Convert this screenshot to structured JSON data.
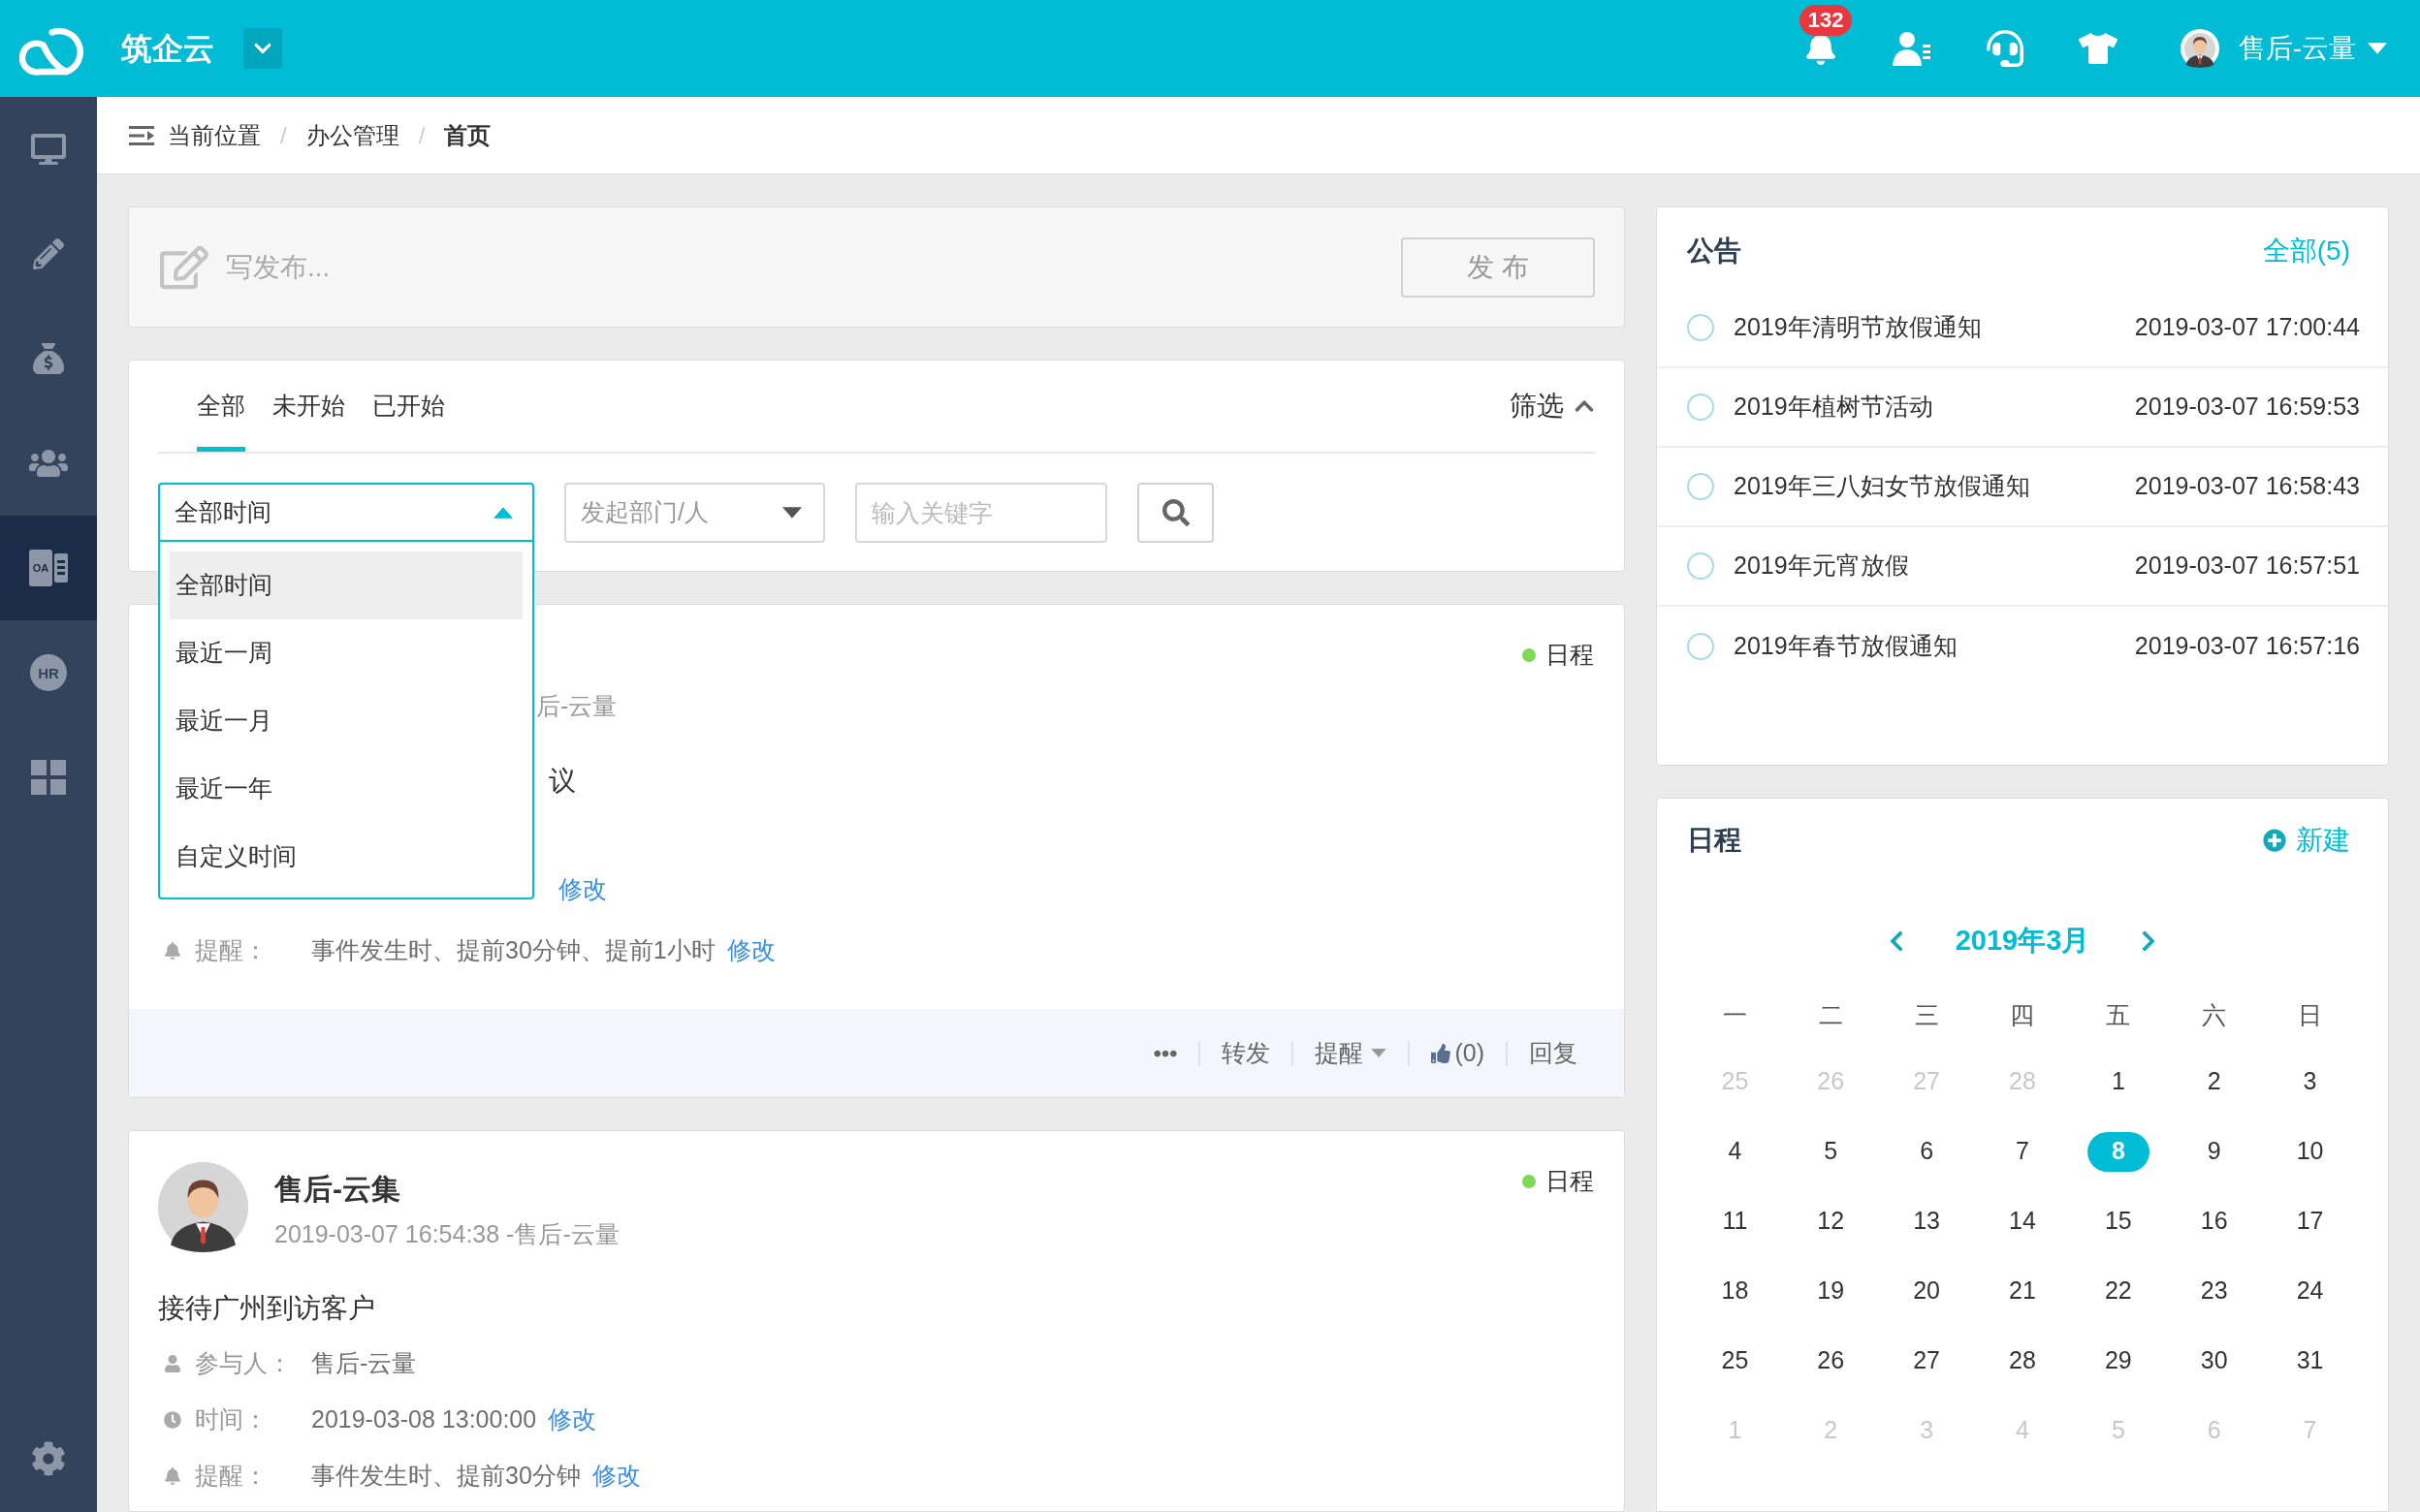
{
  "header": {
    "brand": "筑企云",
    "notifications": {
      "count": "132"
    },
    "user": {
      "name": "售后-云量"
    }
  },
  "sidebar": {
    "items": [
      {
        "selected": false
      },
      {
        "selected": false
      },
      {
        "selected": false
      },
      {
        "selected": false
      },
      {
        "selected": true,
        "icon_text": "OA"
      },
      {
        "selected": false,
        "icon_text": "HR"
      },
      {
        "selected": false
      }
    ]
  },
  "breadcrumb": {
    "items": [
      {
        "kind": "label",
        "text": "当前位置"
      },
      {
        "kind": "separator",
        "text": "/"
      },
      {
        "kind": "link",
        "text": "办公管理"
      },
      {
        "kind": "separator",
        "text": "/"
      },
      {
        "kind": "current",
        "text": "首页"
      }
    ]
  },
  "composer": {
    "placeholder": "写发布...",
    "button": "发 布"
  },
  "filter": {
    "tabs": [
      {
        "label": "全部",
        "selected": true
      },
      {
        "label": "未开始",
        "selected": false
      },
      {
        "label": "已开始",
        "selected": false
      }
    ],
    "toggle": {
      "label": "筛选",
      "expanded": true
    },
    "time_select": {
      "value": "全部时间",
      "expanded": true,
      "options": [
        {
          "label": "全部时间",
          "selected": true
        },
        {
          "label": "最近一周",
          "selected": false
        },
        {
          "label": "最近一月",
          "selected": false
        },
        {
          "label": "最近一年",
          "selected": false
        },
        {
          "label": "自定义时间",
          "selected": false
        }
      ]
    },
    "department_select": {
      "placeholder": "发起部门/人"
    },
    "keyword": {
      "placeholder": "输入关键字"
    }
  },
  "feed": {
    "items": [
      {
        "tag": "日程",
        "meta": "后-云量",
        "title": "议",
        "rows": [
          {
            "kind": "time",
            "action": "修改"
          },
          {
            "kind": "reminder",
            "label": "提醒：",
            "value": "事件发生时、提前30分钟、提前1小时",
            "action": "修改"
          }
        ],
        "actions": [
          {
            "kind": "more"
          },
          {
            "kind": "text",
            "label": "转发"
          },
          {
            "kind": "menu",
            "label": "提醒"
          },
          {
            "kind": "like",
            "label": "(0)"
          },
          {
            "kind": "text",
            "label": "回复"
          }
        ]
      },
      {
        "tag": "日程",
        "name": "售后-云集",
        "meta": "2019-03-07 16:54:38 -售后-云量",
        "title": "接待广州到访客户",
        "rows": [
          {
            "kind": "participant",
            "label": "参与人：",
            "value": "售后-云量"
          },
          {
            "kind": "time",
            "label": "时间：",
            "value": "2019-03-08 13:00:00",
            "action": "修改"
          },
          {
            "kind": "reminder",
            "label": "提醒：",
            "value": "事件发生时、提前30分钟",
            "action": "修改"
          }
        ]
      }
    ]
  },
  "notices": {
    "title": "公告",
    "more": "全部(5)",
    "items": [
      {
        "title": "2019年清明节放假通知",
        "time": "2019-03-07 17:00:44"
      },
      {
        "title": "2019年植树节活动",
        "time": "2019-03-07 16:59:53"
      },
      {
        "title": "2019年三八妇女节放假通知",
        "time": "2019-03-07 16:58:43"
      },
      {
        "title": "2019年元宵放假",
        "time": "2019-03-07 16:57:51"
      },
      {
        "title": "2019年春节放假通知",
        "time": "2019-03-07 16:57:16"
      }
    ]
  },
  "schedule": {
    "title": "日程",
    "new": "新建",
    "month": "2019年3月",
    "weekdays": [
      "一",
      "二",
      "三",
      "四",
      "五",
      "六",
      "日"
    ],
    "days": [
      {
        "label": "25",
        "muted": true,
        "selected": false
      },
      {
        "label": "26",
        "muted": true,
        "selected": false
      },
      {
        "label": "27",
        "muted": true,
        "selected": false
      },
      {
        "label": "28",
        "muted": true,
        "selected": false
      },
      {
        "label": "1",
        "muted": false,
        "selected": false
      },
      {
        "label": "2",
        "muted": false,
        "selected": false
      },
      {
        "label": "3",
        "muted": false,
        "selected": false
      },
      {
        "label": "4",
        "muted": false,
        "selected": false
      },
      {
        "label": "5",
        "muted": false,
        "selected": false
      },
      {
        "label": "6",
        "muted": false,
        "selected": false
      },
      {
        "label": "7",
        "muted": false,
        "selected": false
      },
      {
        "label": "8",
        "muted": false,
        "selected": true
      },
      {
        "label": "9",
        "muted": false,
        "selected": false
      },
      {
        "label": "10",
        "muted": false,
        "selected": false
      },
      {
        "label": "11",
        "muted": false,
        "selected": false
      },
      {
        "label": "12",
        "muted": false,
        "selected": false
      },
      {
        "label": "13",
        "muted": false,
        "selected": false
      },
      {
        "label": "14",
        "muted": false,
        "selected": false
      },
      {
        "label": "15",
        "muted": false,
        "selected": false
      },
      {
        "label": "16",
        "muted": false,
        "selected": false
      },
      {
        "label": "17",
        "muted": false,
        "selected": false
      },
      {
        "label": "18",
        "muted": false,
        "selected": false
      },
      {
        "label": "19",
        "muted": false,
        "selected": false
      },
      {
        "label": "20",
        "muted": false,
        "selected": false
      },
      {
        "label": "21",
        "muted": false,
        "selected": false
      },
      {
        "label": "22",
        "muted": false,
        "selected": false
      },
      {
        "label": "23",
        "muted": false,
        "selected": false
      },
      {
        "label": "24",
        "muted": false,
        "selected": false
      },
      {
        "label": "25",
        "muted": false,
        "selected": false
      },
      {
        "label": "26",
        "muted": false,
        "selected": false
      },
      {
        "label": "27",
        "muted": false,
        "selected": false
      },
      {
        "label": "28",
        "muted": false,
        "selected": false
      },
      {
        "label": "29",
        "muted": false,
        "selected": false
      },
      {
        "label": "30",
        "muted": false,
        "selected": false
      },
      {
        "label": "31",
        "muted": false,
        "selected": false
      },
      {
        "label": "1",
        "muted": true,
        "selected": false
      },
      {
        "label": "2",
        "muted": true,
        "selected": false
      },
      {
        "label": "3",
        "muted": true,
        "selected": false
      },
      {
        "label": "4",
        "muted": true,
        "selected": false
      },
      {
        "label": "5",
        "muted": true,
        "selected": false
      },
      {
        "label": "6",
        "muted": true,
        "selected": false
      },
      {
        "label": "7",
        "muted": true,
        "selected": false
      }
    ]
  }
}
